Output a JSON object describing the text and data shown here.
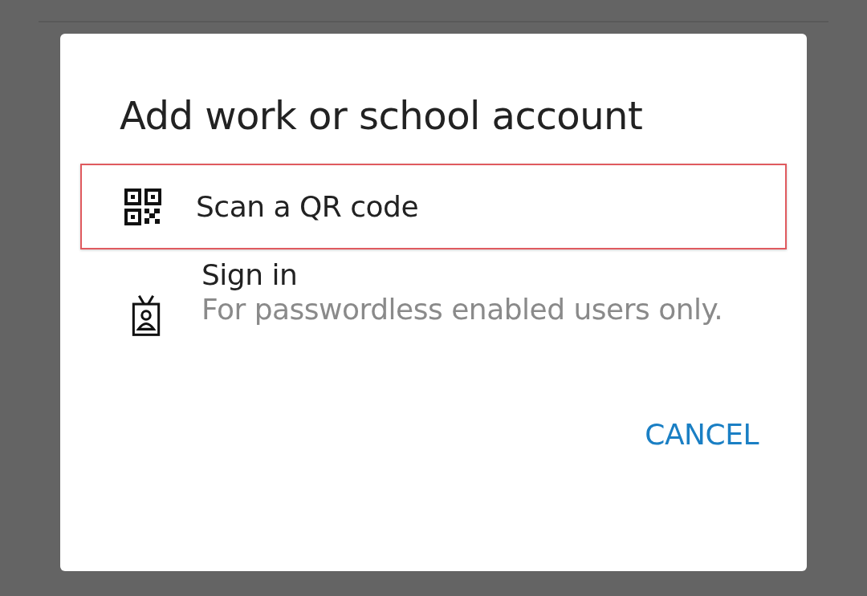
{
  "dialog": {
    "title": "Add work or school account",
    "options": [
      {
        "kind": "qr",
        "label": "Scan a QR code",
        "highlighted": true
      },
      {
        "kind": "badge",
        "label": "Sign in",
        "description": "For passwordless enabled users only.",
        "highlighted": false
      }
    ],
    "buttons": [
      "CANCEL"
    ]
  }
}
